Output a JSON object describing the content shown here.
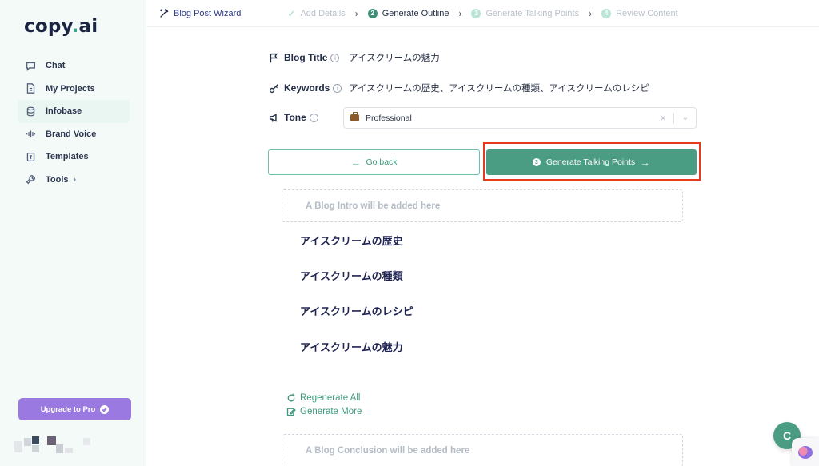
{
  "sidebar": {
    "logo": "copy",
    "logo_dot": ".",
    "logo_suffix": "ai",
    "items": [
      {
        "label": "Chat",
        "icon": "chat-icon"
      },
      {
        "label": "My Projects",
        "icon": "document-icon"
      },
      {
        "label": "Infobase",
        "icon": "database-icon"
      },
      {
        "label": "Brand Voice",
        "icon": "soundwave-icon"
      },
      {
        "label": "Templates",
        "icon": "template-icon"
      },
      {
        "label": "Tools",
        "icon": "wrench-icon"
      }
    ],
    "upgrade_label": "Upgrade to Pro"
  },
  "stepbar": {
    "wizard_label": "Blog Post Wizard",
    "steps": [
      {
        "num": "",
        "label": "Add Details",
        "state": "done"
      },
      {
        "num": "2",
        "label": "Generate Outline",
        "state": "current"
      },
      {
        "num": "3",
        "label": "Generate Talking Points",
        "state": "future"
      },
      {
        "num": "4",
        "label": "Review Content",
        "state": "future"
      }
    ]
  },
  "form": {
    "title_label": "Blog Title",
    "title_value": "アイスクリームの魅力",
    "keywords_label": "Keywords",
    "keywords_value": "アイスクリームの歴史、アイスクリームの種類、アイスクリームのレシピ",
    "tone_label": "Tone",
    "tone_value": "Professional",
    "info_glyph": "i"
  },
  "buttons": {
    "back_label": "Go back",
    "generate_step": "3",
    "generate_label": "Generate Talking Points"
  },
  "outline": {
    "intro_placeholder": "A Blog Intro will be added here",
    "headings": [
      "アイスクリームの歴史",
      "アイスクリームの種類",
      "アイスクリームのレシピ",
      "アイスクリームの魅力"
    ],
    "regenerate_label": "Regenerate All",
    "generate_more_label": "Generate More",
    "conclusion_placeholder": "A Blog Conclusion will be added here"
  },
  "floating": {
    "chat_letter": "C"
  },
  "colors": {
    "accent": "#4a9c82",
    "upgrade": "#9a7ae0",
    "highlight": "#e53a1c"
  }
}
